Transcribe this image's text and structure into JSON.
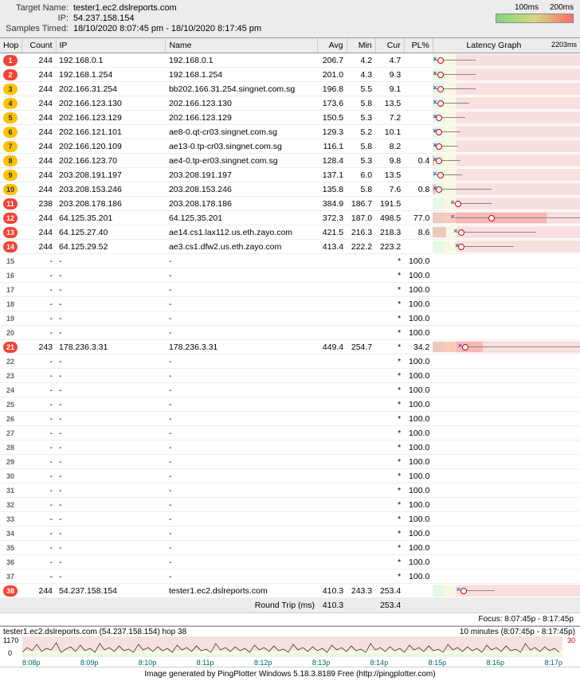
{
  "header": {
    "labels": {
      "target": "Target Name:",
      "ip": "IP:",
      "samples": "Samples Timed:"
    },
    "target": "tester1.ec2.dslreports.com",
    "ip": "54.237.158.154",
    "samples": "18/10/2020 8:07:45 pm - 18/10/2020 8:17:45 pm",
    "scale_lo": "100ms",
    "scale_hi": "200ms"
  },
  "columns": {
    "hop": "Hop",
    "count": "Count",
    "ip": "IP",
    "name": "Name",
    "avg": "Avg",
    "min": "Min",
    "cur": "Cur",
    "pl": "PL%",
    "graph": "Latency Graph",
    "graph_max": "2203ms"
  },
  "hops": [
    {
      "n": 1,
      "badge": "red",
      "count": 244,
      "ip": "192.168.0.1",
      "name": "192.168.0.1",
      "avg": "206.7",
      "min": "4.2",
      "cur": "4.7",
      "pl": "",
      "gx": 0,
      "gmin": 1,
      "gmax": 29,
      "gdot": 3
    },
    {
      "n": 2,
      "badge": "red",
      "count": 244,
      "ip": "192.168.1.254",
      "name": "192.168.1.254",
      "avg": "201.0",
      "min": "4.3",
      "cur": "9.3",
      "pl": "",
      "gx": 0,
      "gmin": 1,
      "gmax": 29,
      "gdot": 3
    },
    {
      "n": 3,
      "badge": "yellow",
      "count": 244,
      "ip": "202.166.31.254",
      "name": "bb202.166.31.254.singnet.com.sg",
      "avg": "196.8",
      "min": "5.5",
      "cur": "9.1",
      "pl": "",
      "gx": 0,
      "gmin": 1,
      "gmax": 29,
      "gdot": 3
    },
    {
      "n": 4,
      "badge": "yellow",
      "count": 244,
      "ip": "202.166.123.130",
      "name": "202.166.123.130",
      "avg": "173.6",
      "min": "5.8",
      "cur": "13.5",
      "pl": "",
      "gx": 0,
      "gmin": 1,
      "gmax": 25,
      "gdot": 3
    },
    {
      "n": 5,
      "badge": "yellow",
      "count": 244,
      "ip": "202.166.123.129",
      "name": "202.166.123.129",
      "avg": "150.5",
      "min": "5.3",
      "cur": "7.2",
      "pl": "",
      "gx": 0,
      "gmin": 1,
      "gmax": 22,
      "gdot": 2
    },
    {
      "n": 6,
      "badge": "yellow",
      "count": 244,
      "ip": "202.166.121.101",
      "name": "ae8-0.qt-cr03.singnet.com.sg",
      "avg": "129.3",
      "min": "5.2",
      "cur": "10.1",
      "pl": "",
      "gx": 0,
      "gmin": 1,
      "gmax": 19,
      "gdot": 2
    },
    {
      "n": 7,
      "badge": "yellow",
      "count": 244,
      "ip": "202.166.120.109",
      "name": "ae13-0.tp-cr03.singnet.com.sg",
      "avg": "116.1",
      "min": "5.8",
      "cur": "8.2",
      "pl": "",
      "gx": 0,
      "gmin": 1,
      "gmax": 17,
      "gdot": 2
    },
    {
      "n": 8,
      "badge": "yellow",
      "count": 244,
      "ip": "202.166.123.70",
      "name": "ae4-0.tp-er03.singnet.com.sg",
      "avg": "128.4",
      "min": "5.3",
      "cur": "9.8",
      "pl": "0.4",
      "gx": 0,
      "gmin": 1,
      "gmax": 19,
      "gdot": 2,
      "plw": 1
    },
    {
      "n": 9,
      "badge": "yellow",
      "count": 244,
      "ip": "203.208.191.197",
      "name": "203.208.191.197",
      "avg": "137.1",
      "min": "6.0",
      "cur": "13.5",
      "pl": "",
      "gx": 0,
      "gmin": 1,
      "gmax": 20,
      "gdot": 3
    },
    {
      "n": 10,
      "badge": "yellow",
      "count": 244,
      "ip": "203.208.153.246",
      "name": "203.208.153.246",
      "avg": "135.8",
      "min": "5.8",
      "cur": "7.6",
      "pl": "0.8",
      "gx": 0,
      "gmin": 1,
      "gmax": 40,
      "gdot": 2,
      "plw": 2
    },
    {
      "n": 11,
      "badge": "red",
      "count": 238,
      "ip": "203.208.178.186",
      "name": "203.208.178.186",
      "avg": "384.9",
      "min": "186.7",
      "cur": "191.5",
      "pl": "",
      "gx": 12,
      "gmin": 14,
      "gmax": 40,
      "gdot": 15
    },
    {
      "n": 12,
      "badge": "red",
      "count": 244,
      "ip": "64.125.35.201",
      "name": "64.125.35.201",
      "avg": "372.3",
      "min": "187.0",
      "cur": "498.5",
      "pl": "77.0",
      "gx": 12,
      "gmin": 14,
      "gmax": 100,
      "gdot": 38,
      "plw": 77
    },
    {
      "n": 13,
      "badge": "red",
      "count": 244,
      "ip": "64.125.27.40",
      "name": "ae14.cs1.lax112.us.eth.zayo.com",
      "avg": "421.5",
      "min": "216.3",
      "cur": "218.3",
      "pl": "8.6",
      "gx": 14,
      "gmin": 16,
      "gmax": 70,
      "gdot": 17,
      "plw": 9
    },
    {
      "n": 14,
      "badge": "red",
      "count": 244,
      "ip": "64.125.29.52",
      "name": "ae3.cs1.dfw2.us.eth.zayo.com",
      "avg": "413.4",
      "min": "222.2",
      "cur": "223.2",
      "pl": "",
      "gx": 15,
      "gmin": 16,
      "gmax": 55,
      "gdot": 17
    },
    {
      "n": 15,
      "nostat": true
    },
    {
      "n": 16,
      "nostat": true
    },
    {
      "n": 17,
      "nostat": true
    },
    {
      "n": 18,
      "nostat": true
    },
    {
      "n": 19,
      "nostat": true
    },
    {
      "n": 20,
      "nostat": true
    },
    {
      "n": 21,
      "badge": "red",
      "count": 243,
      "ip": "178.236.3.31",
      "name": "178.236.3.31",
      "avg": "449.4",
      "min": "254.7",
      "cur": "*",
      "pl": "34.2",
      "gx": 17,
      "gmin": 19,
      "gmax": 100,
      "gdot": 20,
      "plw": 34
    },
    {
      "n": 22,
      "nostat": true
    },
    {
      "n": 23,
      "nostat": true
    },
    {
      "n": 24,
      "nostat": true
    },
    {
      "n": 25,
      "nostat": true
    },
    {
      "n": 26,
      "nostat": true
    },
    {
      "n": 27,
      "nostat": true
    },
    {
      "n": 28,
      "nostat": true
    },
    {
      "n": 29,
      "nostat": true
    },
    {
      "n": 30,
      "nostat": true
    },
    {
      "n": 31,
      "nostat": true
    },
    {
      "n": 32,
      "nostat": true
    },
    {
      "n": 33,
      "nostat": true
    },
    {
      "n": 34,
      "nostat": true
    },
    {
      "n": 35,
      "nostat": true
    },
    {
      "n": 36,
      "nostat": true
    },
    {
      "n": 37,
      "nostat": true
    },
    {
      "n": 38,
      "badge": "red",
      "count": 244,
      "ip": "54.237.158.154",
      "name": "tester1.ec2.dslreports.com",
      "avg": "410.3",
      "min": "243.3",
      "cur": "253.4",
      "pl": "",
      "gx": 16,
      "gmin": 18,
      "gmax": 42,
      "gdot": 19
    }
  ],
  "nostat_values": {
    "count": "-",
    "ip": "-",
    "name": "-",
    "avg": "",
    "min": "",
    "cur": "*",
    "pl": "100.0"
  },
  "round_trip": {
    "label": "Round Trip (ms)",
    "avg": "410.3",
    "min": "",
    "cur": "253.4"
  },
  "focus": "Focus: 8:07:45p - 8:17:45p",
  "bottom": {
    "label": "tester1.ec2.dslreports.com (54.237.158.154) hop 38",
    "right": "10 minutes (8:07:45p - 8:17:45p)",
    "y_hi": "1170",
    "y_lo": "0",
    "y_pl": "30",
    "ticks": [
      "8:08p",
      "8:09p",
      "8:10p",
      "8:11p",
      "8:12p",
      "8:13p",
      "8:14p",
      "8:15p",
      "8:16p",
      "8:17p"
    ]
  },
  "footer": "Image generated by PingPlotter Windows 5.18.3.8189 Free (http://pingplotter.com)",
  "chart_data": {
    "type": "table",
    "title": "PingPlotter traceroute latency per hop",
    "columns": [
      "Hop",
      "Count",
      "IP",
      "Name",
      "Avg(ms)",
      "Min(ms)",
      "Cur(ms)",
      "PL%"
    ],
    "latency_graph_xmax_ms": 2203,
    "rows": [
      [
        1,
        244,
        "192.168.0.1",
        "192.168.0.1",
        206.7,
        4.2,
        4.7,
        null
      ],
      [
        2,
        244,
        "192.168.1.254",
        "192.168.1.254",
        201.0,
        4.3,
        9.3,
        null
      ],
      [
        3,
        244,
        "202.166.31.254",
        "bb202.166.31.254.singnet.com.sg",
        196.8,
        5.5,
        9.1,
        null
      ],
      [
        4,
        244,
        "202.166.123.130",
        "202.166.123.130",
        173.6,
        5.8,
        13.5,
        null
      ],
      [
        5,
        244,
        "202.166.123.129",
        "202.166.123.129",
        150.5,
        5.3,
        7.2,
        null
      ],
      [
        6,
        244,
        "202.166.121.101",
        "ae8-0.qt-cr03.singnet.com.sg",
        129.3,
        5.2,
        10.1,
        null
      ],
      [
        7,
        244,
        "202.166.120.109",
        "ae13-0.tp-cr03.singnet.com.sg",
        116.1,
        5.8,
        8.2,
        null
      ],
      [
        8,
        244,
        "202.166.123.70",
        "ae4-0.tp-er03.singnet.com.sg",
        128.4,
        5.3,
        9.8,
        0.4
      ],
      [
        9,
        244,
        "203.208.191.197",
        "203.208.191.197",
        137.1,
        6.0,
        13.5,
        null
      ],
      [
        10,
        244,
        "203.208.153.246",
        "203.208.153.246",
        135.8,
        5.8,
        7.6,
        0.8
      ],
      [
        11,
        238,
        "203.208.178.186",
        "203.208.178.186",
        384.9,
        186.7,
        191.5,
        null
      ],
      [
        12,
        244,
        "64.125.35.201",
        "64.125.35.201",
        372.3,
        187.0,
        498.5,
        77.0
      ],
      [
        13,
        244,
        "64.125.27.40",
        "ae14.cs1.lax112.us.eth.zayo.com",
        421.5,
        216.3,
        218.3,
        8.6
      ],
      [
        14,
        244,
        "64.125.29.52",
        "ae3.cs1.dfw2.us.eth.zayo.com",
        413.4,
        222.2,
        223.2,
        null
      ],
      [
        15,
        null,
        null,
        null,
        null,
        null,
        null,
        100.0
      ],
      [
        16,
        null,
        null,
        null,
        null,
        null,
        null,
        100.0
      ],
      [
        17,
        null,
        null,
        null,
        null,
        null,
        null,
        100.0
      ],
      [
        18,
        null,
        null,
        null,
        null,
        null,
        null,
        100.0
      ],
      [
        19,
        null,
        null,
        null,
        null,
        null,
        null,
        100.0
      ],
      [
        20,
        null,
        null,
        null,
        null,
        null,
        null,
        100.0
      ],
      [
        21,
        243,
        "178.236.3.31",
        "178.236.3.31",
        449.4,
        254.7,
        null,
        34.2
      ],
      [
        22,
        null,
        null,
        null,
        null,
        null,
        null,
        100.0
      ],
      [
        23,
        null,
        null,
        null,
        null,
        null,
        null,
        100.0
      ],
      [
        24,
        null,
        null,
        null,
        null,
        null,
        null,
        100.0
      ],
      [
        25,
        null,
        null,
        null,
        null,
        null,
        null,
        100.0
      ],
      [
        26,
        null,
        null,
        null,
        null,
        null,
        null,
        100.0
      ],
      [
        27,
        null,
        null,
        null,
        null,
        null,
        null,
        100.0
      ],
      [
        28,
        null,
        null,
        null,
        null,
        null,
        null,
        100.0
      ],
      [
        29,
        null,
        null,
        null,
        null,
        null,
        null,
        100.0
      ],
      [
        30,
        null,
        null,
        null,
        null,
        null,
        null,
        100.0
      ],
      [
        31,
        null,
        null,
        null,
        null,
        null,
        null,
        100.0
      ],
      [
        32,
        null,
        null,
        null,
        null,
        null,
        null,
        100.0
      ],
      [
        33,
        null,
        null,
        null,
        null,
        null,
        null,
        100.0
      ],
      [
        34,
        null,
        null,
        null,
        null,
        null,
        null,
        100.0
      ],
      [
        35,
        null,
        null,
        null,
        null,
        null,
        null,
        100.0
      ],
      [
        36,
        null,
        null,
        null,
        null,
        null,
        null,
        100.0
      ],
      [
        37,
        null,
        null,
        null,
        null,
        null,
        null,
        100.0
      ],
      [
        38,
        244,
        "54.237.158.154",
        "tester1.ec2.dslreports.com",
        410.3,
        243.3,
        253.4,
        null
      ]
    ],
    "round_trip_ms": {
      "avg": 410.3,
      "cur": 253.4
    },
    "timeline": {
      "ylim_ms": [
        0,
        1170
      ],
      "pl_right_axis_max": 30,
      "x_ticks": [
        "8:08p",
        "8:09p",
        "8:10p",
        "8:11p",
        "8:12p",
        "8:13p",
        "8:14p",
        "8:15p",
        "8:16p",
        "8:17p"
      ]
    }
  }
}
